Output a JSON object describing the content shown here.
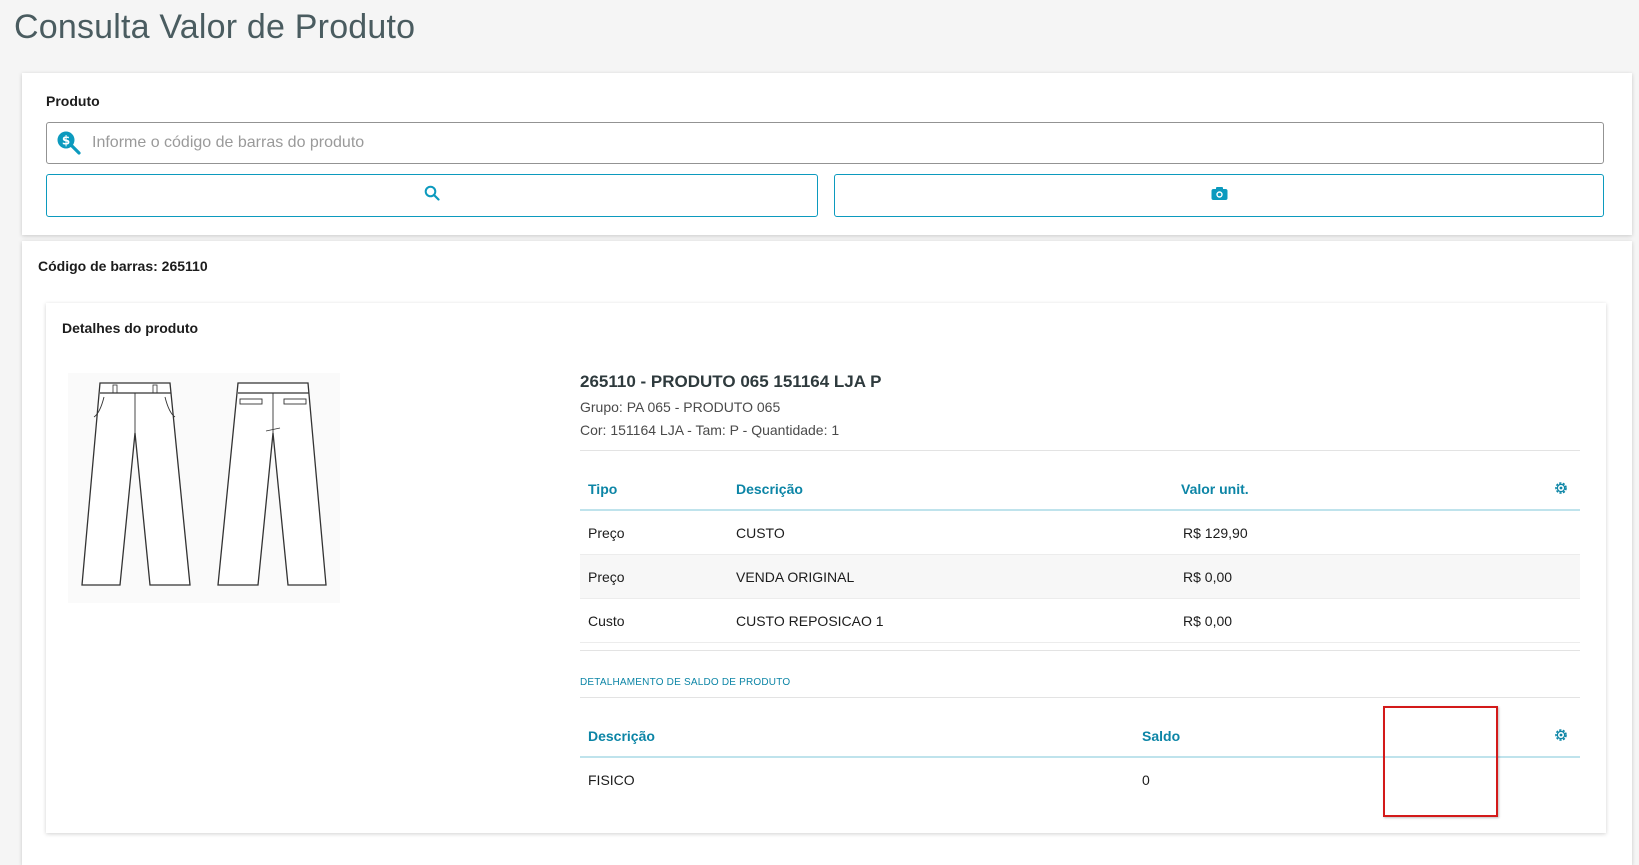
{
  "page": {
    "title": "Consulta Valor de Produto"
  },
  "search": {
    "label": "Produto",
    "placeholder": "Informe o código de barras do produto",
    "value": "",
    "field_icon": "price-search-icon",
    "search_button_icon": "search-icon",
    "camera_button_icon": "camera-icon"
  },
  "result": {
    "barcode_line": "Código de barras: 265110",
    "details_title": "Detalhes do produto",
    "product": {
      "name": "265110 - PRODUTO 065 151164 LJA P",
      "group": "Grupo: PA 065 - PRODUTO 065",
      "attributes": "Cor: 151164 LJA - Tam: P - Quantidade: 1"
    },
    "price_table": {
      "headers": [
        "Tipo",
        "Descrição",
        "Valor unit."
      ],
      "rows": [
        [
          "Preço",
          "CUSTO",
          "R$ 129,90"
        ],
        [
          "Preço",
          "VENDA ORIGINAL",
          "R$ 0,00"
        ],
        [
          "Custo",
          "CUSTO REPOSICAO 1",
          "R$ 0,00"
        ]
      ]
    },
    "balance_section_label": "DETALHAMENTO DE SALDO DE PRODUTO",
    "balance_table": {
      "headers": [
        "Descrição",
        "Saldo"
      ],
      "rows": [
        [
          "FISICO",
          "0"
        ]
      ]
    }
  },
  "colors": {
    "accent": "#0c9abe",
    "header_text": "#0c85a6",
    "highlight": "#d31a1a"
  }
}
